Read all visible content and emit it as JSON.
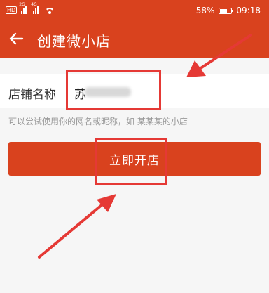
{
  "status_bar": {
    "network_badge": "HD",
    "signal_tags": [
      "2G",
      "4G"
    ],
    "battery_percent": "58%",
    "battery_level": 0.58,
    "time": "09:18",
    "icons": [
      "signal-icon",
      "wifi-icon",
      "battery-icon"
    ]
  },
  "header": {
    "back_icon": "arrow-left-icon",
    "title": "创建微小店"
  },
  "form": {
    "name_label": "店铺名称",
    "name_value": "苏",
    "hint": "可以尝试使用你的网名或昵称，如 某某某的小店"
  },
  "actions": {
    "open_shop_label": "立即开店"
  },
  "colors": {
    "primary": "#d9421e",
    "annotation": "#e53935",
    "background": "#f6f6f6"
  }
}
